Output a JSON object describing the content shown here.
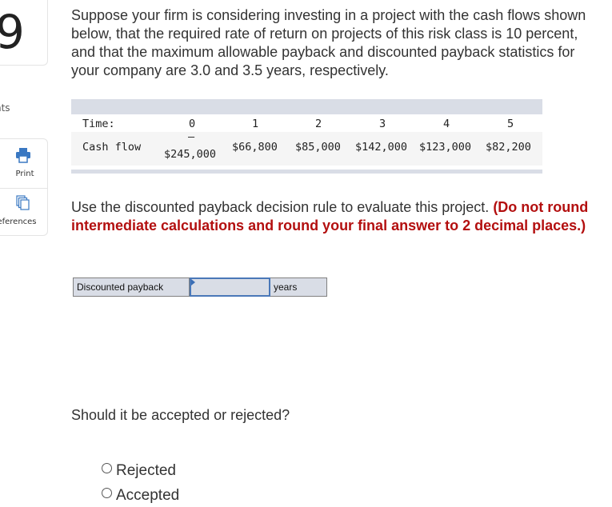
{
  "sidebar": {
    "question_number": "9",
    "points_label_partial": "nts",
    "tools": [
      {
        "label": "Print",
        "icon": "printer-icon"
      },
      {
        "label": "eferences",
        "icon": "references-icon"
      }
    ]
  },
  "problem": {
    "intro": "Suppose your firm is considering investing in a project with the cash flows shown below, that the required rate of return on projects of this risk class is 10 percent, and that the maximum allowable payback and discounted payback statistics for your company are 3.0 and 3.5 years, respectively.",
    "table": {
      "time_label": "Time:",
      "cash_flow_label": "Cash flow",
      "periods": [
        "0",
        "1",
        "2",
        "3",
        "4",
        "5"
      ],
      "cash_flows": [
        "−$245,000",
        "$66,800",
        "$85,000",
        "$142,000",
        "$123,000",
        "$82,200"
      ],
      "cash_flow_0_sign": "–",
      "cash_flow_0_amount": "$245,000"
    },
    "instruction_plain": "Use the discounted payback decision rule to evaluate this project. ",
    "instruction_bold": "(Do not round intermediate calculations and round your final answer to 2 decimal places.)"
  },
  "answer": {
    "label": "Discounted payback",
    "value": "",
    "unit": "years"
  },
  "decision": {
    "question": "Should it be accepted or rejected?",
    "options": [
      {
        "label": "Rejected",
        "selected": false
      },
      {
        "label": "Accepted",
        "selected": false
      }
    ]
  }
}
